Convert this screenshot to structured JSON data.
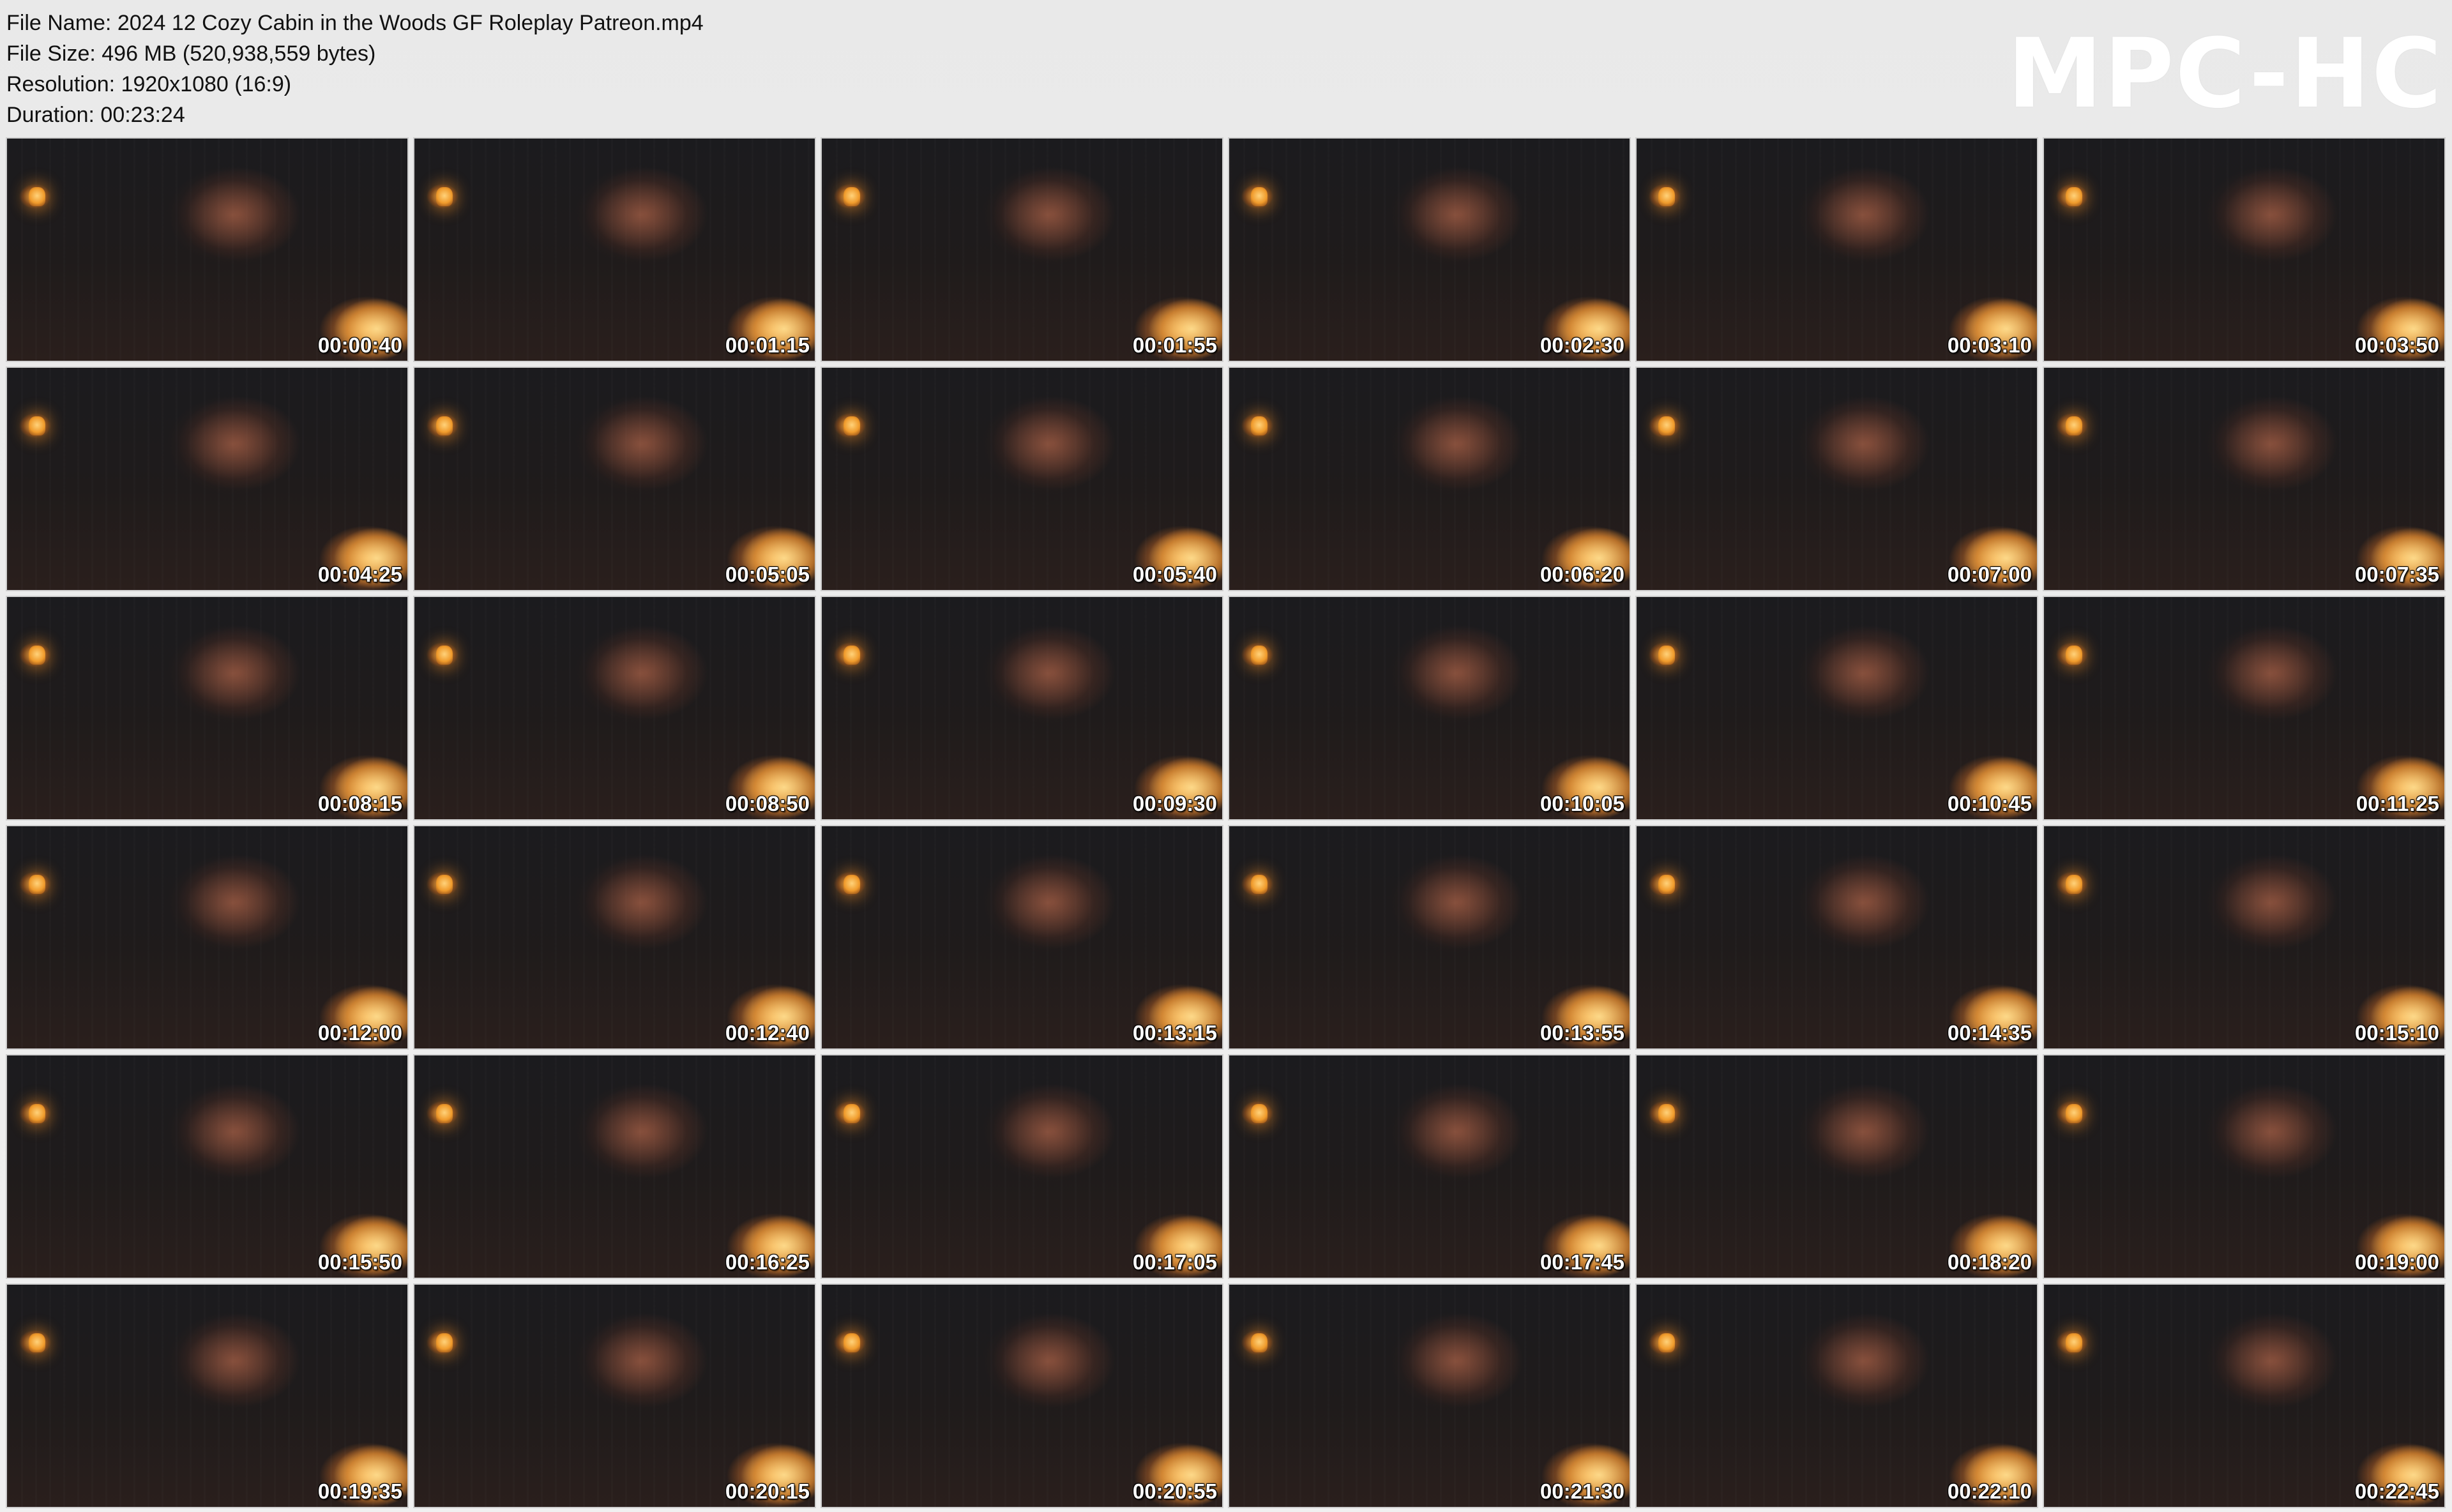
{
  "file_info": {
    "file_name": "File Name: 2024 12 Cozy Cabin in the Woods GF Roleplay Patreon.mp4",
    "file_size": "File Size: 496 MB (520,938,559 bytes)",
    "resolution": "Resolution: 1920x1080 (16:9)",
    "duration": "Duration: 00:23:24"
  },
  "logo": "MPC-HC",
  "thumbnails": [
    {
      "timestamp": "00:00:40"
    },
    {
      "timestamp": "00:01:15"
    },
    {
      "timestamp": "00:01:55"
    },
    {
      "timestamp": "00:02:30"
    },
    {
      "timestamp": "00:03:10"
    },
    {
      "timestamp": "00:03:50"
    },
    {
      "timestamp": "00:04:25"
    },
    {
      "timestamp": "00:05:05"
    },
    {
      "timestamp": "00:05:40"
    },
    {
      "timestamp": "00:06:20"
    },
    {
      "timestamp": "00:07:00"
    },
    {
      "timestamp": "00:07:35"
    },
    {
      "timestamp": "00:08:15"
    },
    {
      "timestamp": "00:08:50"
    },
    {
      "timestamp": "00:09:30"
    },
    {
      "timestamp": "00:10:05"
    },
    {
      "timestamp": "00:10:45"
    },
    {
      "timestamp": "00:11:25"
    },
    {
      "timestamp": "00:12:00"
    },
    {
      "timestamp": "00:12:40"
    },
    {
      "timestamp": "00:13:15"
    },
    {
      "timestamp": "00:13:55"
    },
    {
      "timestamp": "00:14:35"
    },
    {
      "timestamp": "00:15:10"
    },
    {
      "timestamp": "00:15:50"
    },
    {
      "timestamp": "00:16:25"
    },
    {
      "timestamp": "00:17:05"
    },
    {
      "timestamp": "00:17:45"
    },
    {
      "timestamp": "00:18:20"
    },
    {
      "timestamp": "00:19:00"
    },
    {
      "timestamp": "00:19:35"
    },
    {
      "timestamp": "00:20:15"
    },
    {
      "timestamp": "00:20:55"
    },
    {
      "timestamp": "00:21:30"
    },
    {
      "timestamp": "00:22:10"
    },
    {
      "timestamp": "00:22:45"
    }
  ],
  "colors": {
    "background": "#ededed",
    "text": "#111111",
    "logo": "#ffffff",
    "timestamp": "#ffffff"
  }
}
